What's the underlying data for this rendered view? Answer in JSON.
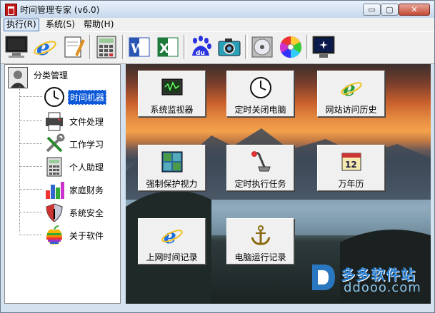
{
  "window": {
    "title": "时间管理专家  (v6.0)",
    "buttons": {
      "minimize": "▭",
      "maximize": "▢",
      "close": "✕"
    }
  },
  "menu": [
    {
      "label": "执行(R)",
      "active": true
    },
    {
      "label": "系统(S)",
      "active": false
    },
    {
      "label": "帮助(H)",
      "active": false
    }
  ],
  "toolbar": [
    {
      "icon": "monitor-icon"
    },
    {
      "icon": "internet-explorer-icon"
    },
    {
      "icon": "notepad-pen-icon"
    },
    {
      "icon": "calculator-icon"
    },
    {
      "icon": "word-icon"
    },
    {
      "icon": "excel-icon"
    },
    {
      "icon": "baidu-icon"
    },
    {
      "icon": "camera-icon"
    },
    {
      "icon": "disc-player-icon"
    },
    {
      "icon": "color-disc-icon"
    },
    {
      "icon": "screen-star-icon"
    }
  ],
  "sidebar": {
    "root_label": "分类管理",
    "items": [
      {
        "label": "时间机器",
        "icon": "clock-icon",
        "selected": true
      },
      {
        "label": "文件处理",
        "icon": "printer-icon",
        "selected": false
      },
      {
        "label": "工作学习",
        "icon": "tools-icon",
        "selected": false
      },
      {
        "label": "个人助理",
        "icon": "calculator-icon",
        "selected": false
      },
      {
        "label": "家庭财务",
        "icon": "bar-chart-icon",
        "selected": false
      },
      {
        "label": "系统安全",
        "icon": "shield-icon",
        "selected": false
      },
      {
        "label": "关于软件",
        "icon": "apple-icon",
        "selected": false
      }
    ]
  },
  "tiles": [
    {
      "label": "系统监视器",
      "icon": "oscilloscope-icon"
    },
    {
      "label": "定时关闭电脑",
      "icon": "clock-icon"
    },
    {
      "label": "网站访问历史",
      "icon": "internet-explorer-icon"
    },
    {
      "label": "强制保护视力",
      "icon": "window-grid-icon"
    },
    {
      "label": "定时执行任务",
      "icon": "joystick-icon"
    },
    {
      "label": "万年历",
      "icon": "calendar-icon"
    },
    {
      "label": "上网时间记录",
      "icon": "internet-explorer-icon"
    },
    {
      "label": "电脑运行记录",
      "icon": "anchor-icon"
    }
  ],
  "watermark": {
    "name": "多多软件站",
    "url": "ddooo.com"
  }
}
